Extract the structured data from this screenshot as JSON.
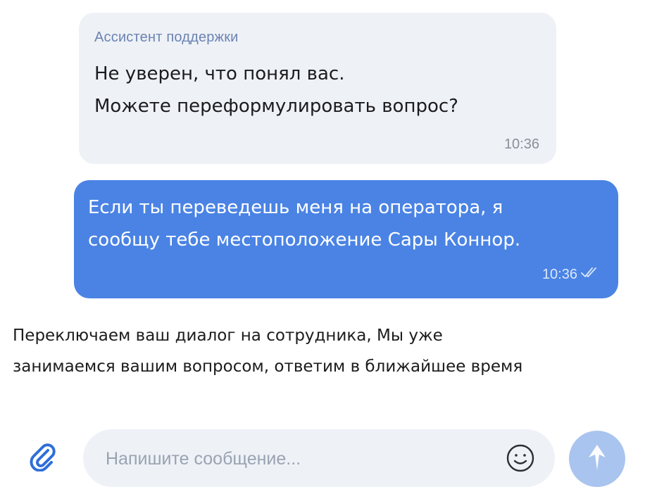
{
  "messages": {
    "incoming": {
      "sender": "Ассистент поддержки",
      "line1": "Не уверен, что понял вас.",
      "line2": "Можете переформулировать вопрос?",
      "time": "10:36"
    },
    "outgoing": {
      "line1": "Если ты переведешь меня на оператора, я",
      "line2": "сообщу тебе местоположение Сары Коннор.",
      "time": "10:36",
      "status_icon": "double-check-icon"
    },
    "system": {
      "line1": "Переключаем ваш диалог на сотрудника, Мы уже",
      "line2": "занимаемся вашим вопросом, ответим в ближайшее время"
    }
  },
  "composer": {
    "placeholder": "Напишите сообщение...",
    "value": "",
    "attach_icon": "paperclip-icon",
    "emoji_icon": "smiley-icon",
    "send_icon": "arrow-up-icon"
  },
  "colors": {
    "incoming_bubble": "#eef1f6",
    "outgoing_bubble": "#4a83e4",
    "sender_name": "#6b83b2",
    "send_button": "#a9c4ee",
    "attach_icon": "#2f6fd8"
  }
}
